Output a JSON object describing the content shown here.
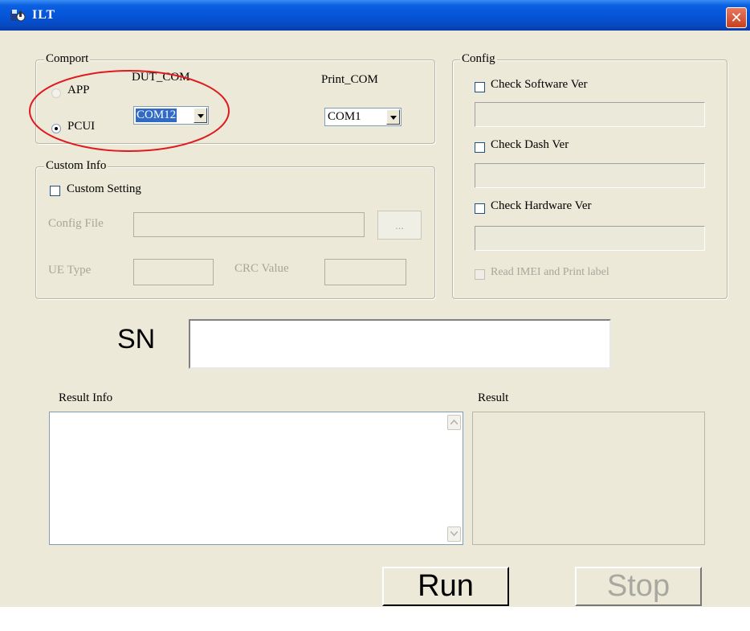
{
  "window": {
    "title": "ILT",
    "close_glyph": "✕"
  },
  "comport": {
    "legend": "Comport",
    "app_label": "APP",
    "pcui_label": "PCUI",
    "selected_mode": "PCUI",
    "dut_com": {
      "label": "DUT_COM",
      "value": "COM12"
    },
    "print_com": {
      "label": "Print_COM",
      "value": "COM1"
    }
  },
  "custom_info": {
    "legend": "Custom Info",
    "custom_setting_label": "Custom Setting",
    "config_file_label": "Config File",
    "config_file_value": "",
    "browse_label": "...",
    "ue_type_label": "UE Type",
    "ue_type_value": "",
    "crc_value_label": "CRC Value",
    "crc_value_value": ""
  },
  "config": {
    "legend": "Config",
    "check_software_label": "Check Software Ver",
    "software_value": "",
    "check_dash_label": "Check Dash Ver",
    "dash_value": "",
    "check_hardware_label": "Check  Hardware Ver",
    "hardware_value": "",
    "read_imei_label": "Read  IMEI and Print label"
  },
  "sn": {
    "label": "SN",
    "value": ""
  },
  "result_info": {
    "label": "Result Info",
    "text": ""
  },
  "result": {
    "label": "Result",
    "text": ""
  },
  "buttons": {
    "run": "Run",
    "stop": "Stop"
  },
  "icons": {
    "app": "app-icon",
    "close": "close-icon",
    "dropdown": "chevron-down-icon",
    "scroll_up": "scroll-up-icon",
    "scroll_down": "scroll-down-icon"
  },
  "colors": {
    "titlebar": "#0554d8",
    "window_bg": "#ece9d8",
    "selection": "#316ac5",
    "annotation": "#e0191f",
    "watermark": "#e0e0e0"
  }
}
